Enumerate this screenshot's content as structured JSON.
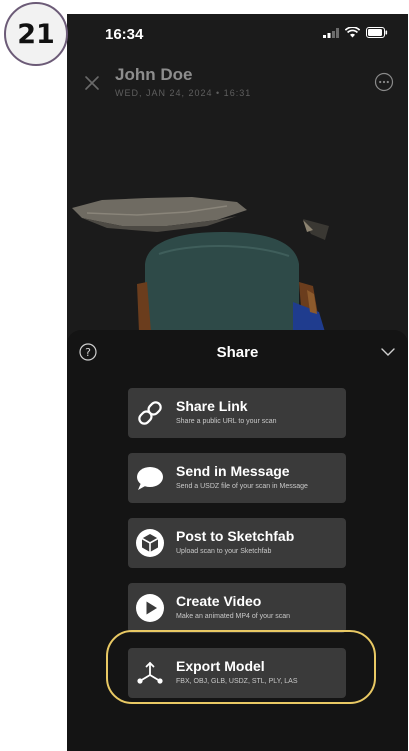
{
  "step_badge": "21",
  "status": {
    "time": "16:34"
  },
  "scan": {
    "title": "John Doe",
    "date": "WED, JAN 24, 2024 • 16:31"
  },
  "share_sheet": {
    "title": "Share",
    "options": [
      {
        "label": "Share Link",
        "description": "Share a public URL to your scan",
        "icon": "link-icon"
      },
      {
        "label": "Send in Message",
        "description": "Send a USDZ file of your scan in Message",
        "icon": "message-bubble-icon"
      },
      {
        "label": "Post to Sketchfab",
        "description": "Upload scan to your Sketchfab",
        "icon": "sketchfab-icon"
      },
      {
        "label": "Create Video",
        "description": "Make an animated MP4 of your scan",
        "icon": "play-icon"
      },
      {
        "label": "Export Model",
        "description": "FBX, OBJ, GLB, USDZ, STL, PLY, LAS",
        "icon": "export-axes-icon"
      }
    ]
  },
  "colors": {
    "highlight": "#e9c964",
    "sheet_background": "#141414",
    "option_background": "#3a3a3a"
  }
}
